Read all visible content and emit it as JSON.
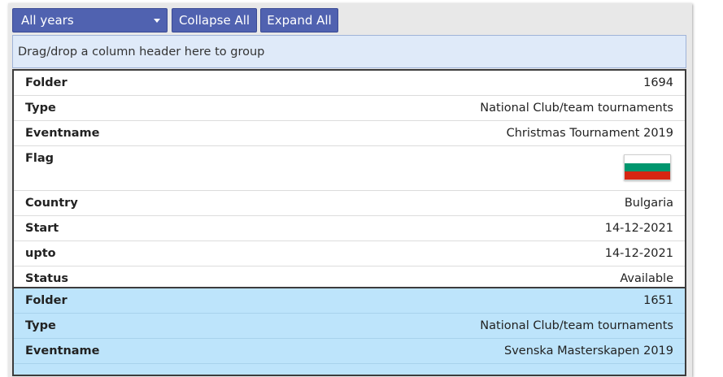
{
  "toolbar": {
    "year_filter": "All years",
    "collapse_label": "Collapse All",
    "expand_label": "Expand All"
  },
  "group_area_text": "Drag/drop a column header here to group",
  "records": [
    {
      "folder_label": "Folder",
      "folder": "1694",
      "type_label": "Type",
      "type": "National Club/team tournaments",
      "eventname_label": "Eventname",
      "eventname": "Christmas Tournament 2019",
      "flag_label": "Flag",
      "flag_colors": [
        "#ffffff",
        "#00966e",
        "#d62612"
      ],
      "country_label": "Country",
      "country": "Bulgaria",
      "start_label": "Start",
      "start": "14-12-2021",
      "upto_label": "upto",
      "upto": "14-12-2021",
      "status_label": "Status",
      "status": "Available"
    },
    {
      "folder_label": "Folder",
      "folder": "1651",
      "type_label": "Type",
      "type": "National Club/team tournaments",
      "eventname_label": "Eventname",
      "eventname": "Svenska Masterskapen 2019"
    }
  ],
  "colors": {
    "button": "#5062b0",
    "group_area": "#dfeaf9",
    "selected_row": "#bde4fb"
  }
}
